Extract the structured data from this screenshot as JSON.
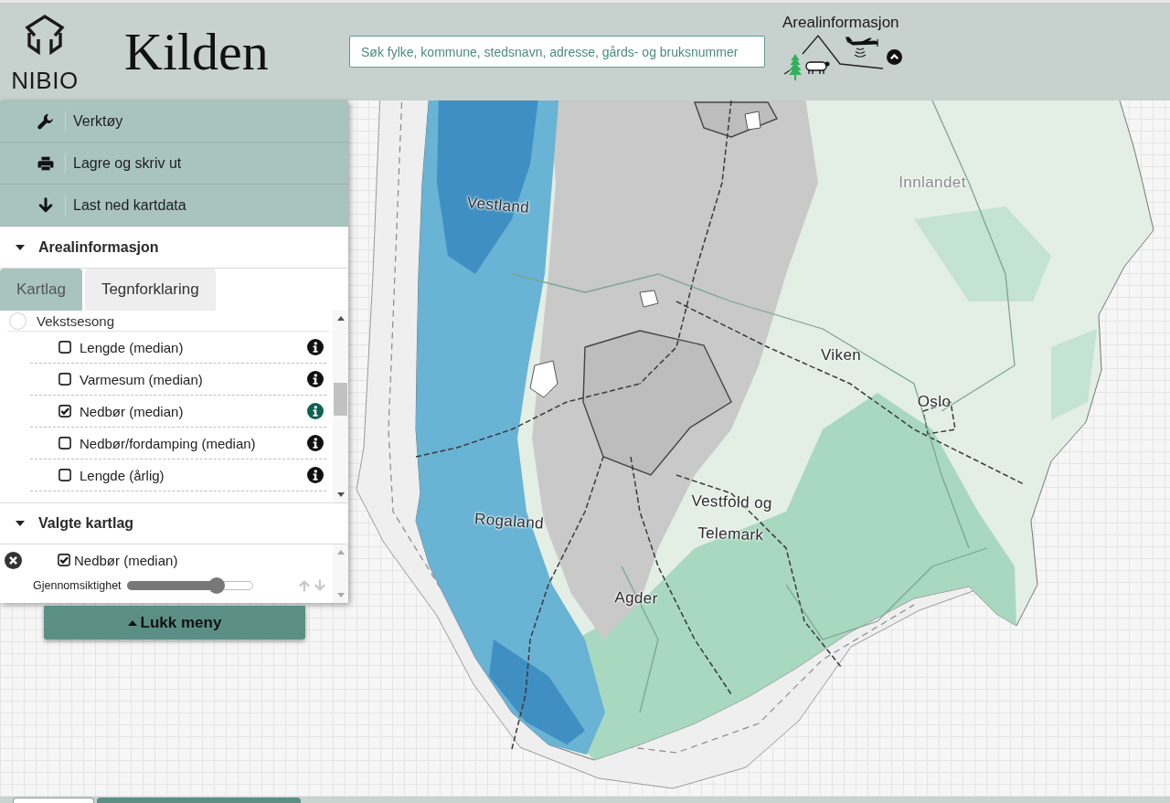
{
  "header": {
    "logo_text": "NIBIO",
    "title": "Kilden",
    "search": {
      "placeholder": "Søk fylke, kommune, stedsnavn, adresse, gårds- og bruksnummer"
    },
    "theme": {
      "label": "Arealinformasjon",
      "expanded": true
    }
  },
  "menu": [
    {
      "kind": "tools",
      "label": "Verktøy"
    },
    {
      "kind": "print",
      "label": "Lagre og skriv ut"
    },
    {
      "kind": "download",
      "label": "Last ned kartdata"
    }
  ],
  "layers_panel": {
    "title": "Arealinformasjon",
    "expanded": true,
    "tabs": [
      {
        "label": "Kartlag",
        "selected": true
      },
      {
        "label": "Tegnforklaring",
        "selected": false
      }
    ],
    "groups": [
      {
        "label": "Vekstsesong",
        "selected": false,
        "children": [
          {
            "label": "Lengde (median)",
            "checked": false
          },
          {
            "label": "Varmesum (median)",
            "checked": false
          },
          {
            "label": "Nedbør (median)",
            "checked": true
          },
          {
            "label": "Nedbør/fordamping (median)",
            "checked": false
          },
          {
            "label": "Lengde (årlig)",
            "checked": false
          }
        ]
      }
    ]
  },
  "selected_layers_panel": {
    "title": "Valgte kartlag",
    "expanded": true,
    "layers": [
      {
        "label": "Nedbør (median)",
        "checked": true,
        "opacity_label": "Gjennomsiktighet",
        "level": 0.71,
        "move_up": {
          "disabled": true
        },
        "move_down": {
          "disabled": true
        }
      }
    ]
  },
  "close_menu_button": {
    "label": "Lukk meny"
  },
  "map": {
    "labels": [
      {
        "text": "Innlandet"
      },
      {
        "text": "Vestland"
      },
      {
        "text": "Viken"
      },
      {
        "text": "Oslo"
      },
      {
        "text": "Vestfold og Telemark"
      },
      {
        "text": "Rogaland"
      },
      {
        "text": "Agder"
      }
    ]
  },
  "drawer_tabs": [
    {
      "selected": false
    },
    {
      "selected": true
    }
  ]
}
